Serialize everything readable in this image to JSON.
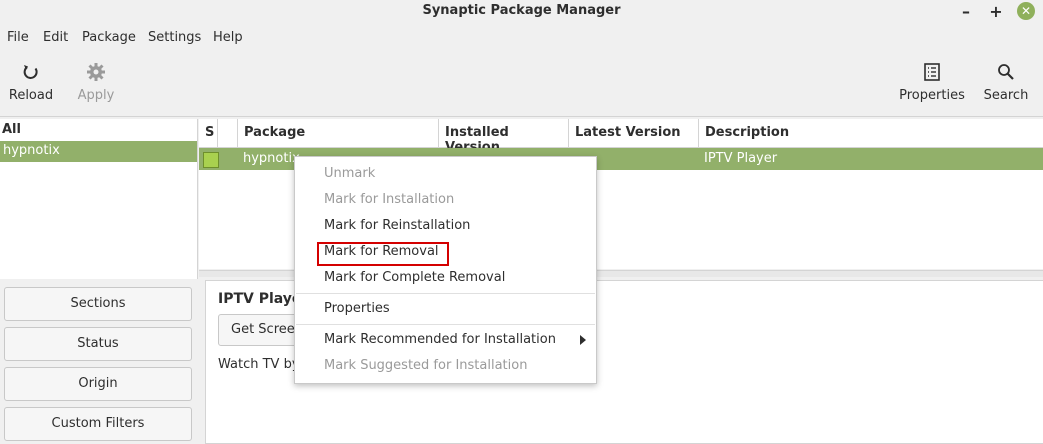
{
  "window": {
    "title": "Synaptic Package Manager",
    "controls": [
      "–",
      "+",
      "✕"
    ]
  },
  "menubar": {
    "items": [
      "File",
      "Edit",
      "Package",
      "Settings",
      "Help"
    ]
  },
  "toolbar": {
    "reload": {
      "label": "Reload",
      "icon": "reload-icon"
    },
    "apply": {
      "label": "Apply",
      "icon": "gear-icon",
      "enabled": false
    },
    "properties": {
      "label": "Properties",
      "icon": "properties-icon"
    },
    "search": {
      "label": "Search",
      "icon": "search-icon"
    }
  },
  "filters": {
    "items": [
      "All",
      "hypnotix"
    ],
    "selected": "hypnotix"
  },
  "package_list": {
    "columns": [
      "S",
      "Package",
      "Installed Version",
      "Latest Version",
      "Description"
    ],
    "rows": [
      {
        "status": "installed",
        "package": "hypnotix",
        "installed_version": "",
        "latest_version": "",
        "description": "IPTV Player"
      }
    ]
  },
  "details": {
    "title": "IPTV Playe",
    "screenshot_button": "Get Screen",
    "description": "Watch TV by"
  },
  "side_buttons": [
    "Sections",
    "Status",
    "Origin",
    "Custom Filters"
  ],
  "context_menu": {
    "items": [
      {
        "label": "Unmark",
        "enabled": false
      },
      {
        "label": "Mark for Installation",
        "enabled": false
      },
      {
        "label": "Mark for Reinstallation",
        "enabled": true
      },
      {
        "label": "Mark for Removal",
        "enabled": true,
        "highlighted": true
      },
      {
        "label": "Mark for Complete Removal",
        "enabled": true
      },
      {
        "label": "Properties",
        "enabled": true
      },
      {
        "label": "Mark Recommended for Installation",
        "enabled": true,
        "submenu": true
      },
      {
        "label": "Mark Suggested for Installation",
        "enabled": false
      }
    ]
  },
  "colors": {
    "selection": "#92b06a",
    "highlight_border": "#d40000",
    "disabled_text": "#9a9a9a"
  }
}
